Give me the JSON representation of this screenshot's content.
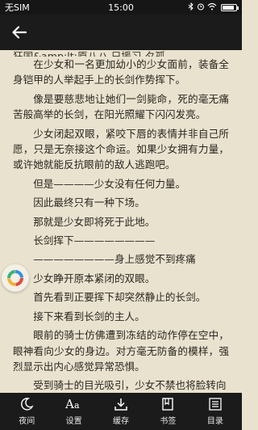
{
  "status_bar": {
    "carrier": "无SIM",
    "time": "15:00",
    "battery_level": 0.9
  },
  "nav": {
    "back_icon": "back-arrow-icon"
  },
  "content": {
    "cut_line": "狂国&amp;lt;原八ハ 只援习 夕孤",
    "paragraphs": [
      "在少女和一名更加幼小的少女面前，装备全身铠甲的人举起手上的长剑作势挥下。",
      "像是要慈悲地让她们一剑毙命，死的毫无痛苦般高举的长剑，在阳光照耀下闪闪发亮。",
      "少女闭起双眼，紧咬下唇的表情并非自己所愿，只是无奈接这个命运。如果少女拥有力量，或许她就能反抗眼前的敌人逃跑吧。",
      "但是————少女没有任何力量。",
      "因此最终只有一种下场。",
      "那就是少女即将死于此地。",
      "长剑挥下————————",
      "————————身上感觉不到疼痛",
      "少女睁开原本紧闭的双眼。",
      "首先看到正要挥下却突然静止的长剑。",
      "接下来看到长剑的主人。",
      "眼前的骑士仿佛遭到冻结的动作停在空中，眼神看向少女的身边。对方毫无防备的模样，强烈显示出内心感觉异常恐惧。",
      "受到骑士的目光吸引，少女不禁也将脸转向"
    ]
  },
  "toolbar": {
    "items": [
      {
        "label": "夜间",
        "icon": "moon-icon"
      },
      {
        "label": "设置",
        "icon": "font-settings-icon"
      },
      {
        "label": "缓存",
        "icon": "download-icon"
      },
      {
        "label": "书签",
        "icon": "bookmark-icon"
      },
      {
        "label": "目录",
        "icon": "list-icon"
      }
    ]
  },
  "colors": {
    "page_background": "#e9e2cf",
    "bar_background": "#1b1b1b",
    "text": "#2a2620"
  }
}
